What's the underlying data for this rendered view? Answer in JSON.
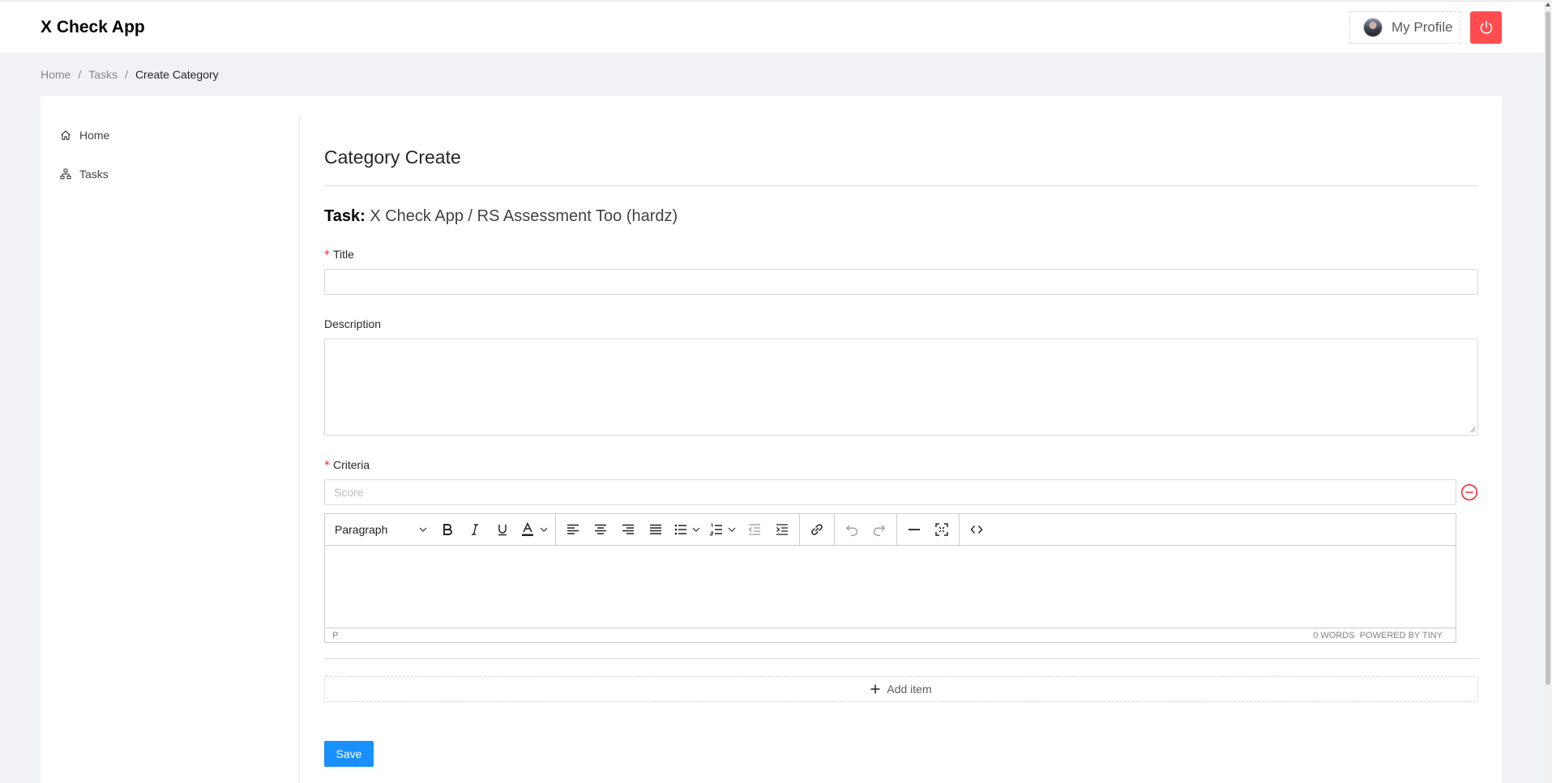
{
  "app": {
    "title": "X Check App"
  },
  "header": {
    "profile_label": "My Profile"
  },
  "breadcrumb": [
    "Home",
    "Tasks",
    "Create Category"
  ],
  "sidebar": {
    "items": [
      {
        "label": "Home",
        "icon": "home-icon"
      },
      {
        "label": "Tasks",
        "icon": "apartment-icon"
      }
    ]
  },
  "form": {
    "title": "Category Create",
    "task_label": "Task:",
    "task_value": "X Check App / RS Assessment Too (hardz)",
    "title_label": "Title",
    "title_value": "",
    "description_label": "Description",
    "criteria_label": "Criteria",
    "score_placeholder": "Score",
    "add_item_label": "Add item",
    "save_label": "Save"
  },
  "editor": {
    "block_format": "Paragraph",
    "status_path": "P",
    "word_count": "0 WORDS",
    "powered_by": "POWERED BY TINY"
  },
  "colors": {
    "primary": "#1890ff",
    "danger": "#ff4d4f",
    "required": "#f5222d"
  }
}
